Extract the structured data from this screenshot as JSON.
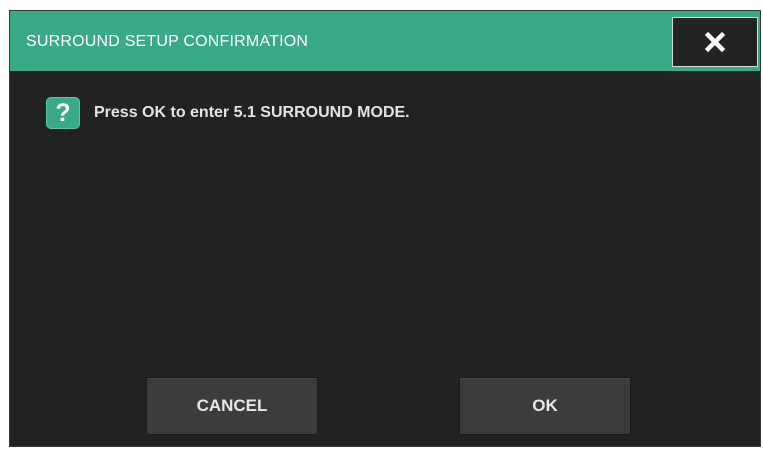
{
  "dialog": {
    "title": "SURROUND SETUP CONFIRMATION",
    "close_icon": "close-icon",
    "message_icon": "question-icon",
    "message_icon_glyph": "?",
    "message": "Press OK to enter 5.1 SURROUND MODE.",
    "accent_color": "#3aa988",
    "background_color": "#222222"
  },
  "buttons": {
    "cancel_label": "CANCEL",
    "ok_label": "OK"
  }
}
